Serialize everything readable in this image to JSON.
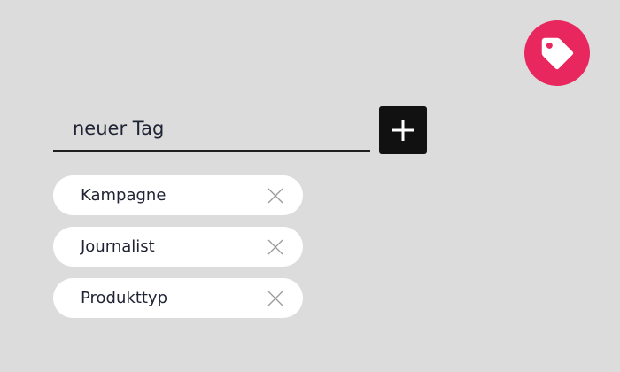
{
  "badge": {
    "icon": "tag-icon",
    "color": "#e8275f"
  },
  "new_tag": {
    "placeholder": "neuer Tag",
    "value": "",
    "add_icon": "plus-icon"
  },
  "tags": [
    {
      "label": "Kampagne",
      "remove_icon": "close-icon"
    },
    {
      "label": "Journalist",
      "remove_icon": "close-icon"
    },
    {
      "label": "Produkttyp",
      "remove_icon": "close-icon"
    }
  ]
}
